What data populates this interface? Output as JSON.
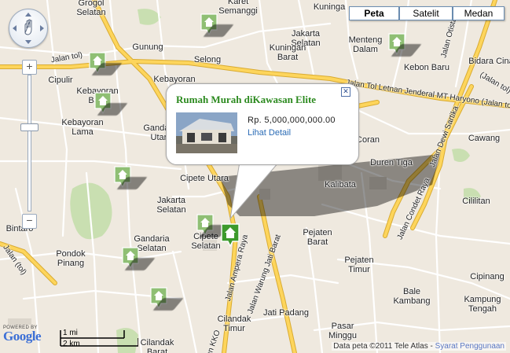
{
  "map_type": {
    "buttons": [
      {
        "label": "Peta",
        "active": true
      },
      {
        "label": "Satelit",
        "active": false
      },
      {
        "label": "Medan",
        "active": false
      }
    ]
  },
  "controls": {
    "zoom_in": "+",
    "zoom_out": "−"
  },
  "place_labels": [
    {
      "key": "grogol",
      "text": "Grogol\nSelatan"
    },
    {
      "key": "karet",
      "text": "Karet\nSemanggi"
    },
    {
      "key": "kuningan",
      "text": "Kuningan"
    },
    {
      "key": "jakselatan1",
      "text": "Jakarta\nSelatan"
    },
    {
      "key": "gunung",
      "text": "Gunung"
    },
    {
      "key": "selong",
      "text": "Selong"
    },
    {
      "key": "kuningbarat",
      "text": "Kuningan\nBarat"
    },
    {
      "key": "menteng",
      "text": "Menteng\nDalam"
    },
    {
      "key": "kebonbaru",
      "text": "Kebon Baru"
    },
    {
      "key": "bidara",
      "text": "Bidara Cina"
    },
    {
      "key": "cipulir",
      "text": "Cipulir"
    },
    {
      "key": "kebayoranbaru",
      "text": "Kebayoran\nBaru"
    },
    {
      "key": "kebayoran",
      "text": "Kebayoran"
    },
    {
      "key": "kebayoranlama",
      "text": "Kebayoran\nLama"
    },
    {
      "key": "gandaria",
      "text": "Gandaria\nUtara"
    },
    {
      "key": "cipeteutara",
      "text": "Cipete Utara"
    },
    {
      "key": "jakselatan2",
      "text": "Jakarta\nSelatan"
    },
    {
      "key": "cawang",
      "text": "Cawang"
    },
    {
      "key": "durentiga",
      "text": "Duren Tiga"
    },
    {
      "key": "kalibata",
      "text": "Kalibata"
    },
    {
      "key": "cililitan",
      "text": "Cililitan"
    },
    {
      "key": "bintaro",
      "text": "Bintaro"
    },
    {
      "key": "gandariaselatan",
      "text": "Gandaria\nSelatan"
    },
    {
      "key": "cipeteselatan",
      "text": "Cipete\nSelatan"
    },
    {
      "key": "pondokpinang",
      "text": "Pondok\nPinang"
    },
    {
      "key": "pejatenbarat",
      "text": "Pejaten\nBarat"
    },
    {
      "key": "pejatentimur",
      "text": "Pejaten\nTimur"
    },
    {
      "key": "balekambang",
      "text": "Bale\nKambang"
    },
    {
      "key": "kampungtengah",
      "text": "Kampung\nTengah"
    },
    {
      "key": "cilandakbarat1",
      "text": "Cilandak\nTimur"
    },
    {
      "key": "jatipadang",
      "text": "Jati Padang"
    },
    {
      "key": "pasarminggu",
      "text": "Pasar\nMinggu"
    },
    {
      "key": "cilandakbarat2",
      "text": "Cilandak\nBarat"
    },
    {
      "key": "sunter",
      "text": "Kuninga"
    },
    {
      "key": "cip2",
      "text": "Cipinang"
    },
    {
      "key": "marker_gap",
      "text": "B"
    },
    {
      "key": "coran",
      "text": "Coran"
    }
  ],
  "road_labels": [
    {
      "key": "tol_haryono",
      "text": "Jalan Tol Letnan Jenderal MT Haryono (Jalan tol)"
    },
    {
      "key": "otista",
      "text": "Jalan Otista"
    },
    {
      "key": "dewi",
      "text": "Jalan Dewi Sartika"
    },
    {
      "key": "condet",
      "text": "Jalan Condet Raya"
    },
    {
      "key": "ampera",
      "text": "Jalan Ampera Raya"
    },
    {
      "key": "warungjati",
      "text": "Jalan Warung Jati Barat"
    },
    {
      "key": "kko",
      "text": "Jalan KKO"
    },
    {
      "key": "jalantol_left",
      "text": "Jalan (tol)"
    },
    {
      "key": "jalantol_right",
      "text": "(Jalan tol)"
    },
    {
      "key": "jalantol_top",
      "text": "Jalan tol)"
    }
  ],
  "info_window": {
    "title": "Rumah Murah diKawasan Elite",
    "price": "Rp. 5,000,000,000.00",
    "link": "Lihat Detail",
    "close_icon": "close-icon"
  },
  "scale": {
    "miles": "1 mi",
    "km": "2 km"
  },
  "footer": {
    "powered_by": "POWERED BY",
    "google": "Google",
    "attribution": "Data peta ©2011 Tele Atlas -",
    "terms": "Syarat Penggunaan"
  },
  "colors": {
    "map_bg": "#efe9df",
    "major_road": "#fdd55c",
    "minor_road": "#ffffff",
    "park": "#c9dfb1",
    "marker_green": "#8fbf74",
    "active_marker": "#3d9a2c",
    "title_green": "#2c8a1f",
    "link_blue": "#2a6bb5"
  }
}
